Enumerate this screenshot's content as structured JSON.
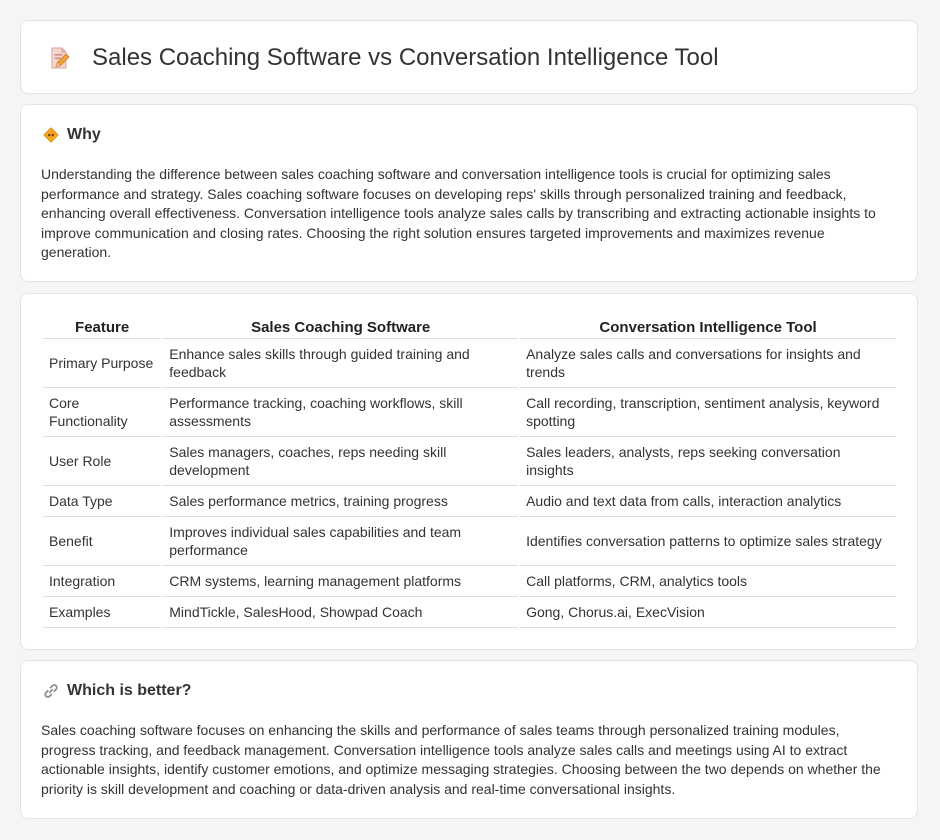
{
  "header": {
    "title": "Sales Coaching Software vs Conversation Intelligence Tool",
    "icon": "document-pencil-icon"
  },
  "why": {
    "title": "Why",
    "icon": "diamond-sign-icon",
    "body": "Understanding the difference between sales coaching software and conversation intelligence tools is crucial for optimizing sales performance and strategy. Sales coaching software focuses on developing reps' skills through personalized training and feedback, enhancing overall effectiveness. Conversation intelligence tools analyze sales calls by transcribing and extracting actionable insights to improve communication and closing rates. Choosing the right solution ensures targeted improvements and maximizes revenue generation."
  },
  "table": {
    "headers": [
      "Feature",
      "Sales Coaching Software",
      "Conversation Intelligence Tool"
    ],
    "rows": [
      [
        "Primary Purpose",
        "Enhance sales skills through guided training and feedback",
        "Analyze sales calls and conversations for insights and trends"
      ],
      [
        "Core Functionality",
        "Performance tracking, coaching workflows, skill assessments",
        "Call recording, transcription, sentiment analysis, keyword spotting"
      ],
      [
        "User Role",
        "Sales managers, coaches, reps needing skill development",
        "Sales leaders, analysts, reps seeking conversation insights"
      ],
      [
        "Data Type",
        "Sales performance metrics, training progress",
        "Audio and text data from calls, interaction analytics"
      ],
      [
        "Benefit",
        "Improves individual sales capabilities and team performance",
        "Identifies conversation patterns to optimize sales strategy"
      ],
      [
        "Integration",
        "CRM systems, learning management platforms",
        "Call platforms, CRM, analytics tools"
      ],
      [
        "Examples",
        "MindTickle, SalesHood, Showpad Coach",
        "Gong, Chorus.ai, ExecVision"
      ]
    ]
  },
  "better": {
    "title": "Which is better?",
    "icon": "link-icon",
    "body": "Sales coaching software focuses on enhancing the skills and performance of sales teams through personalized training modules, progress tracking, and feedback management. Conversation intelligence tools analyze sales calls and meetings using AI to extract actionable insights, identify customer emotions, and optimize messaging strategies. Choosing between the two depends on whether the priority is skill development and coaching or data-driven analysis and real-time conversational insights."
  }
}
